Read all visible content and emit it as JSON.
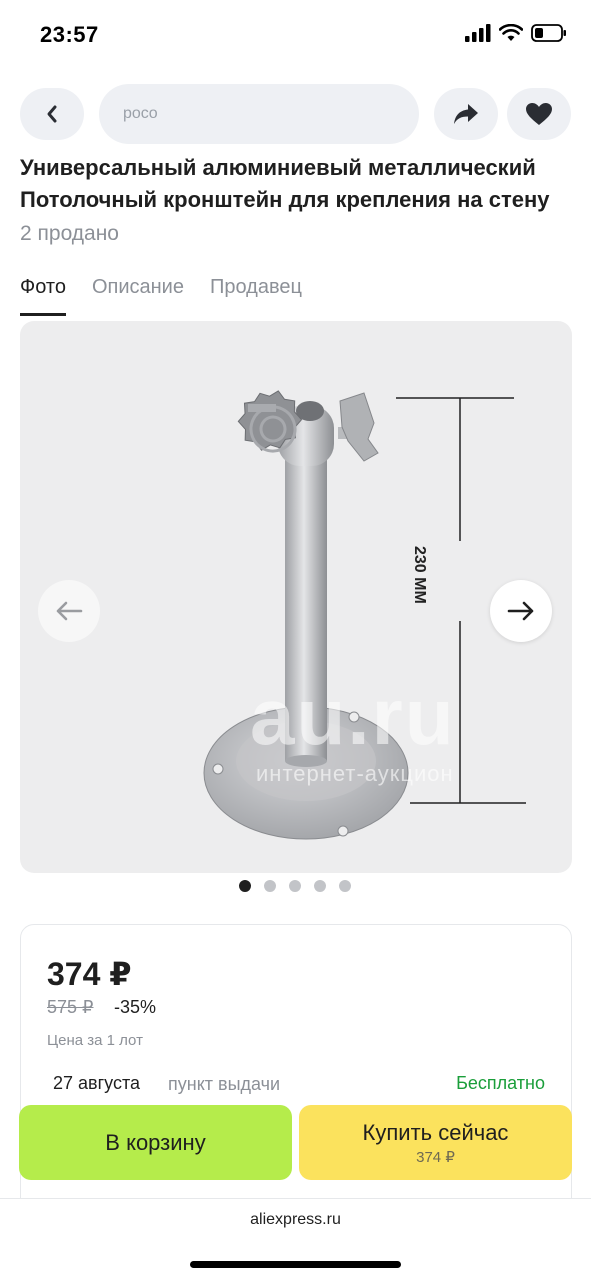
{
  "status": {
    "time": "23:57"
  },
  "header": {
    "search_placeholder": "poco"
  },
  "product": {
    "title": "Универсальный алюминиевый металлический Потолочный кронштейн для крепления на стену",
    "sold": "2 продано"
  },
  "tabs": [
    {
      "label": "Фото",
      "active": true
    },
    {
      "label": "Описание",
      "active": false
    },
    {
      "label": "Продавец",
      "active": false
    }
  ],
  "gallery": {
    "dimension_label": "230 ММ",
    "watermark": "au.ru",
    "watermark_sub": "интернет-аукцион",
    "current_index": 1,
    "total": 5
  },
  "price": {
    "current": "374 ₽",
    "old": "575 ₽",
    "discount": "-35%",
    "per_lot": "Цена за 1 лот"
  },
  "delivery": {
    "date": "27 августа",
    "point": "пункт выдачи",
    "price": "Бесплатно"
  },
  "actions": {
    "cart_label": "В корзину",
    "buy_label": "Купить сейчас",
    "buy_price": "374 ₽"
  },
  "browser": {
    "domain": "aliexpress.ru"
  },
  "colors": {
    "cart": "#b5ec4b",
    "buy": "#fbe25d",
    "free": "#1a9e3a"
  }
}
